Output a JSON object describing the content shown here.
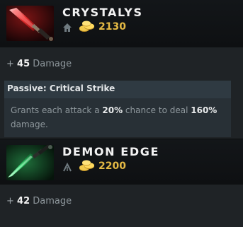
{
  "items": [
    {
      "name": "CRYSTALYS",
      "cost": "2130",
      "icon": "crystalys-item-icon",
      "meta_icon": "home-shop-icon",
      "stat": {
        "plus": "+",
        "value": "45",
        "label": "Damage"
      },
      "passive": {
        "title": "Passive: Critical Strike",
        "desc_1": "Grants each attack a ",
        "desc_chance": "20%",
        "desc_2": " chance to deal ",
        "desc_mult": "160%",
        "desc_3": " damage."
      }
    },
    {
      "name": "DEMON EDGE",
      "cost": "2200",
      "icon": "demon-edge-item-icon",
      "meta_icon": "secret-shop-icon",
      "stat": {
        "plus": "+",
        "value": "42",
        "label": "Damage"
      }
    }
  ],
  "colors": {
    "gold": "#e4b944",
    "header_bg": "#131619",
    "passive_head_bg": "#2f3a42"
  }
}
